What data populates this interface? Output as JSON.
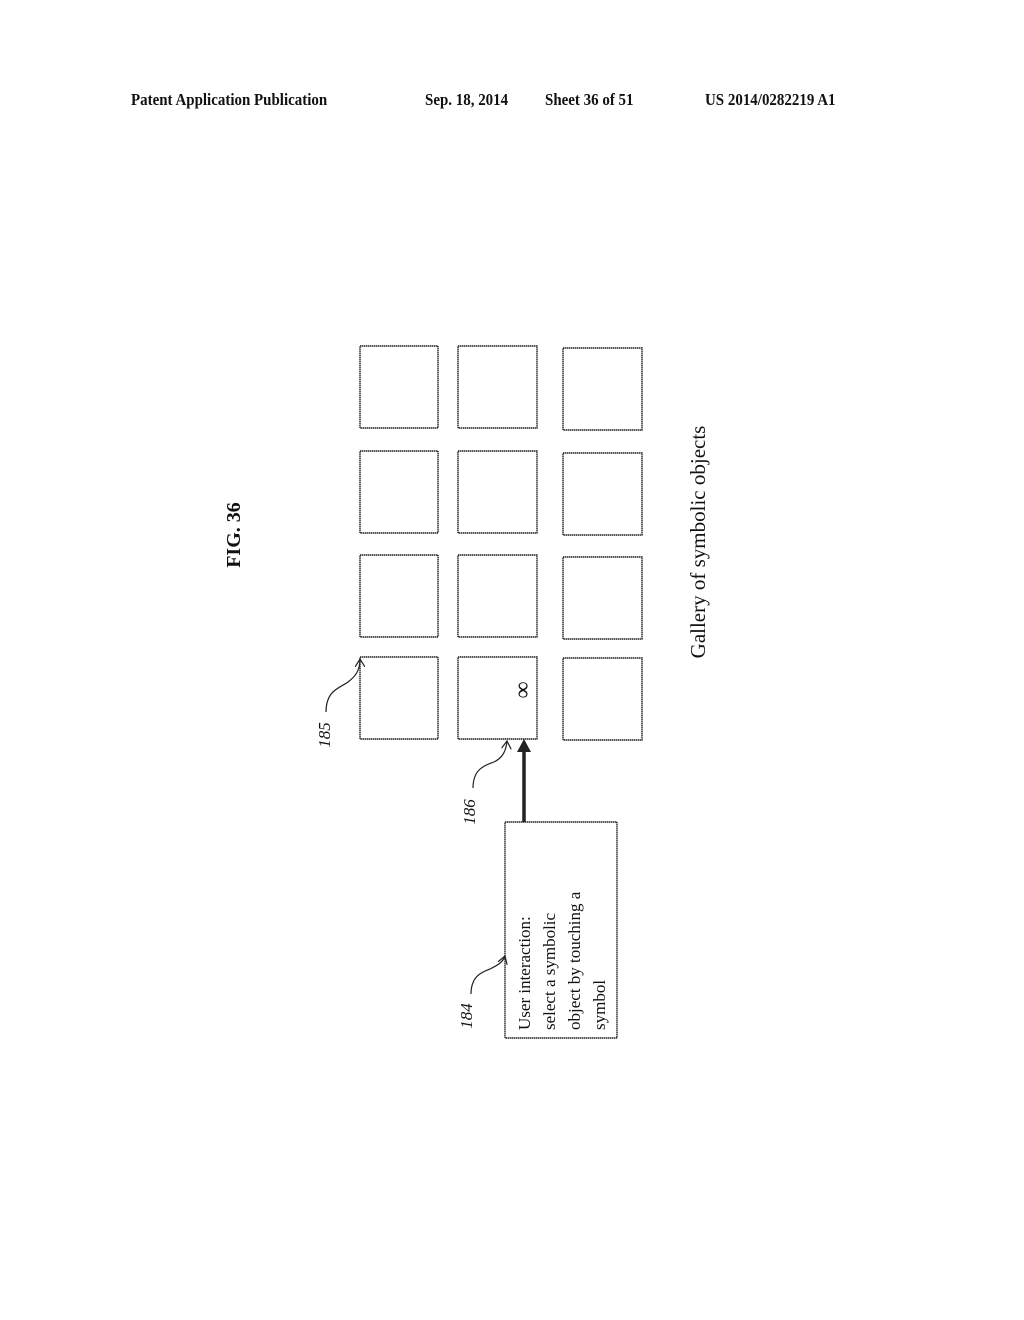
{
  "header": {
    "publication": "Patent Application Publication",
    "date": "Sep. 18, 2014",
    "sheet": "Sheet 36 of 51",
    "number": "US 2014/0282219 A1"
  },
  "figure": {
    "title": "FIG. 36",
    "caption": "Gallery of symbolic objects",
    "grid": {
      "rows": 4,
      "columns": 3
    },
    "selected_symbol": "∞",
    "labels": {
      "gallery_tile": "185",
      "selected_tile": "186",
      "interaction_box": "184"
    },
    "interaction_box": {
      "lines": [
        "User interaction:",
        "select a symbolic",
        "object by touching a",
        "symbol"
      ]
    }
  }
}
